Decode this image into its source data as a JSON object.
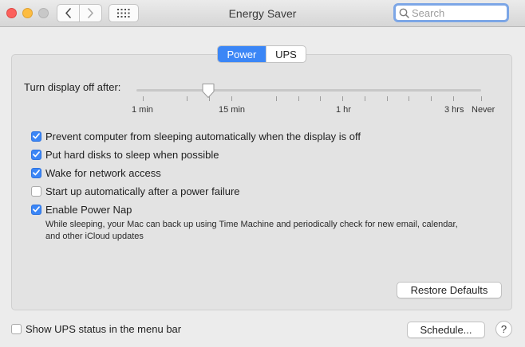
{
  "window": {
    "title": "Energy Saver",
    "search_placeholder": "Search"
  },
  "tabs": [
    {
      "label": "Power",
      "selected": true
    },
    {
      "label": "UPS",
      "selected": false
    }
  ],
  "display_sleep": {
    "label": "Turn display off after:",
    "value": "15 min",
    "ticks": [
      "1 min",
      "15 min",
      "1 hr",
      "3 hrs",
      "Never"
    ]
  },
  "options": [
    {
      "label": "Prevent computer from sleeping automatically when the display is off",
      "checked": true
    },
    {
      "label": "Put hard disks to sleep when possible",
      "checked": true
    },
    {
      "label": "Wake for network access",
      "checked": true
    },
    {
      "label": "Start up automatically after a power failure",
      "checked": false
    },
    {
      "label": "Enable Power Nap",
      "checked": true
    }
  ],
  "power_nap_description": "While sleeping, your Mac can back up using Time Machine and periodically check for new email, calendar, and other iCloud updates",
  "buttons": {
    "restore_defaults": "Restore Defaults",
    "schedule": "Schedule...",
    "help": "?"
  },
  "ups_status": {
    "label": "Show UPS status in the menu bar",
    "checked": false
  },
  "colors": {
    "accent": "#3b86f6",
    "close": "#fc605c",
    "minimize": "#fdbc40",
    "zoom_disabled": "#c8c8c8"
  }
}
